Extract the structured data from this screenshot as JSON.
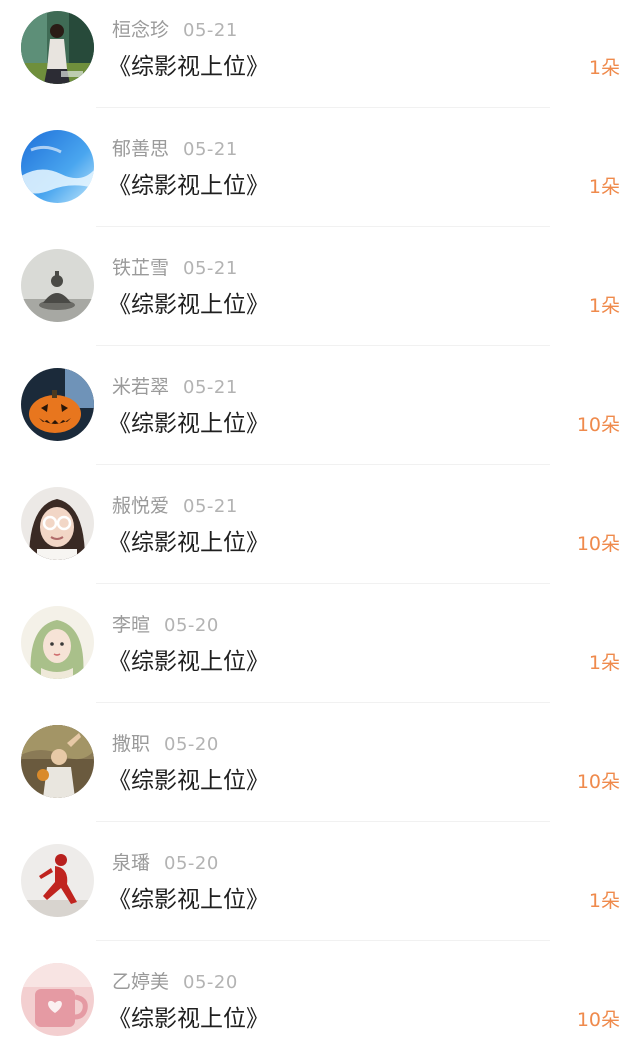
{
  "list": {
    "items": [
      {
        "name": "桓念珍",
        "date": "05-21",
        "title": "《综影视上位》",
        "amount": "1朵",
        "avatar": "avatar-girl-photo"
      },
      {
        "name": "郁善思",
        "date": "05-21",
        "title": "《综影视上位》",
        "amount": "1朵",
        "avatar": "avatar-blue-sky"
      },
      {
        "name": "铁芷雪",
        "date": "05-21",
        "title": "《综影视上位》",
        "amount": "1朵",
        "avatar": "avatar-buddha-statue"
      },
      {
        "name": "米若翠",
        "date": "05-21",
        "title": "《综影视上位》",
        "amount": "10朵",
        "avatar": "avatar-pumpkin"
      },
      {
        "name": "赧悦爱",
        "date": "05-21",
        "title": "《综影视上位》",
        "amount": "10朵",
        "avatar": "avatar-girl-glasses"
      },
      {
        "name": "李暄",
        "date": "05-20",
        "title": "《综影视上位》",
        "amount": "1朵",
        "avatar": "avatar-green-hair-illustration"
      },
      {
        "name": "撒职",
        "date": "05-20",
        "title": "《综影视上位》",
        "amount": "10朵",
        "avatar": "avatar-child-outdoor"
      },
      {
        "name": "泉璠",
        "date": "05-20",
        "title": "《综影视上位》",
        "amount": "1朵",
        "avatar": "avatar-red-dancer"
      },
      {
        "name": "乙婷美",
        "date": "05-20",
        "title": "《综影视上位》",
        "amount": "10朵",
        "avatar": "avatar-pink-mug"
      }
    ]
  }
}
